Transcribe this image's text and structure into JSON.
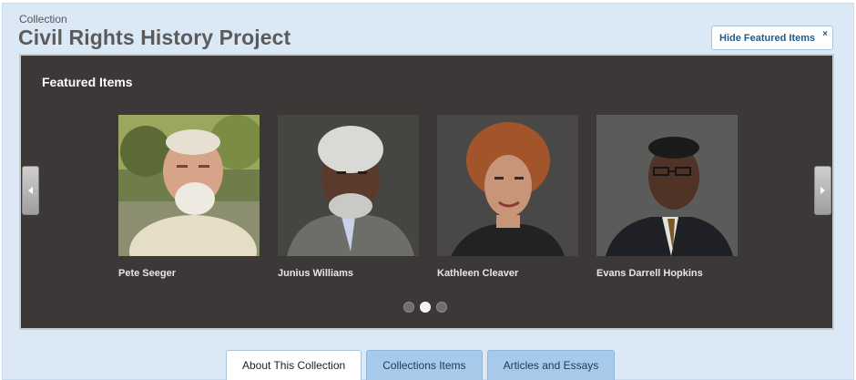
{
  "header": {
    "eyebrow": "Collection",
    "title": "Civil Rights History Project",
    "hide_button_label": "Hide Featured Items",
    "hide_button_close": "×"
  },
  "carousel": {
    "heading": "Featured Items",
    "items": [
      {
        "name": "Pete Seeger"
      },
      {
        "name": "Junius Williams"
      },
      {
        "name": "Kathleen Cleaver"
      },
      {
        "name": "Evans Darrell Hopkins"
      }
    ],
    "page_count": 3,
    "active_page": 2
  },
  "tabs": [
    {
      "label": "About This Collection",
      "active": true
    },
    {
      "label": "Collections Items",
      "active": false
    },
    {
      "label": "Articles and Essays",
      "active": false
    }
  ],
  "colors": {
    "page_background": "#dbe9f7",
    "carousel_background": "#3b3837",
    "tab_inactive": "#a7c9ea",
    "title_gray": "#5b5b5b"
  }
}
